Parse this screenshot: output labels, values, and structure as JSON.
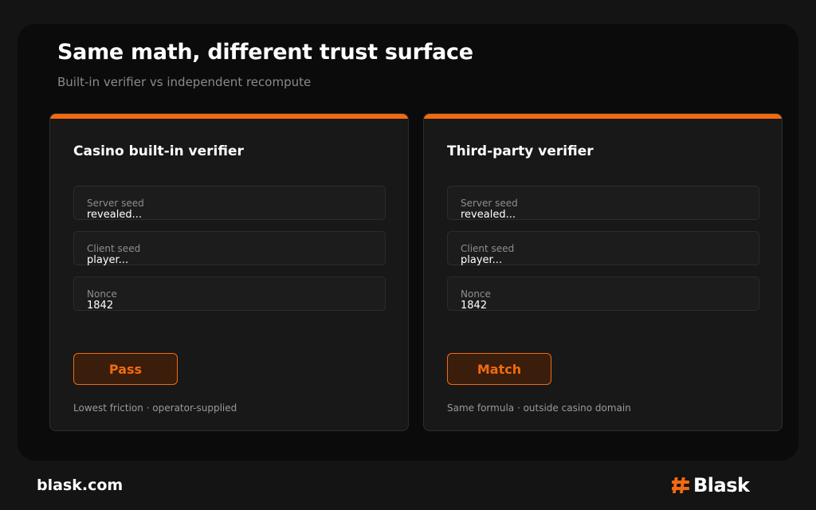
{
  "header": {
    "title": "Same math, different trust surface",
    "subtitle": "Built-in verifier vs independent recompute"
  },
  "panels": [
    {
      "title": "Casino built-in verifier",
      "fields": [
        {
          "label": "Server seed",
          "value": "revealed..."
        },
        {
          "label": "Client seed",
          "value": "player..."
        },
        {
          "label": "Nonce",
          "value": "1842"
        }
      ],
      "status_label": "Pass",
      "caption": "Lowest friction · operator-supplied"
    },
    {
      "title": "Third-party verifier",
      "fields": [
        {
          "label": "Server seed",
          "value": "revealed..."
        },
        {
          "label": "Client seed",
          "value": "player..."
        },
        {
          "label": "Nonce",
          "value": "1842"
        }
      ],
      "status_label": "Match",
      "caption": "Same formula · outside casino domain"
    }
  ],
  "footer": {
    "url": "blask.com",
    "brand_name": "Blask",
    "brand_icon": "hash-logo-icon"
  },
  "colors": {
    "accent": "#f26a10",
    "background": "#141414",
    "panel": "#181818"
  }
}
